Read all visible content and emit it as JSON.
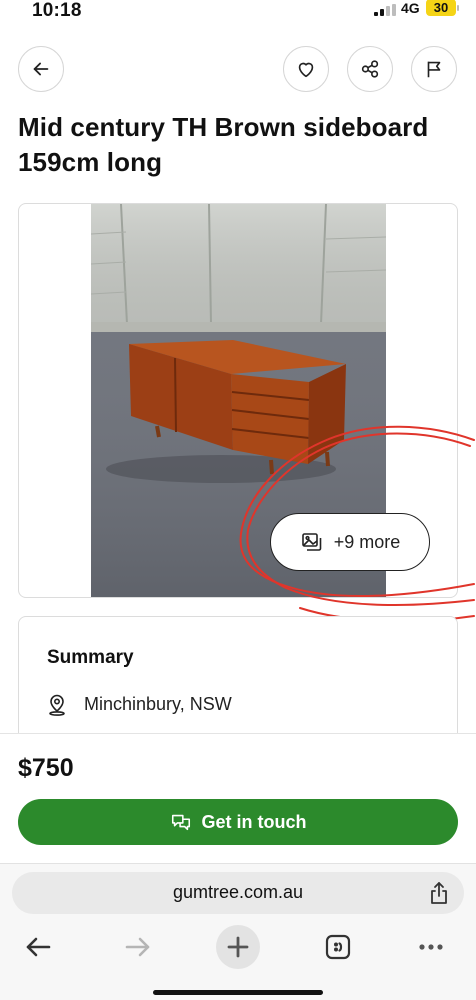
{
  "status_bar": {
    "time": "10:18",
    "network": "4G",
    "battery": "30",
    "battery_color": "#f5d416"
  },
  "header": {
    "back_icon": "arrow-left-icon",
    "favourite_icon": "heart-icon",
    "share_icon": "share-nodes-icon",
    "report_icon": "flag-icon"
  },
  "listing": {
    "title": "Mid century TH Brown sideboard 159cm long",
    "photo_more_label": "+9 more",
    "photo_more_icon": "photo-stack-icon"
  },
  "summary": {
    "heading": "Summary",
    "location_icon": "location-pin-icon",
    "location": "Minchinbury, NSW"
  },
  "sticky_bar": {
    "price": "$750",
    "cta_label": "Get in touch",
    "cta_icon": "chat-bubbles-icon",
    "cta_color": "#2c8a2c"
  },
  "browser": {
    "url": "gumtree.com.au",
    "share_icon": "share-upload-icon",
    "nav_icons": [
      "back-arrow-icon",
      "forward-arrow-icon",
      "new-tab-plus-icon",
      "tabs-icon",
      "more-dots-icon"
    ]
  },
  "colors": {
    "annotation": "#e0352b",
    "accent": "#2c8a2c"
  }
}
